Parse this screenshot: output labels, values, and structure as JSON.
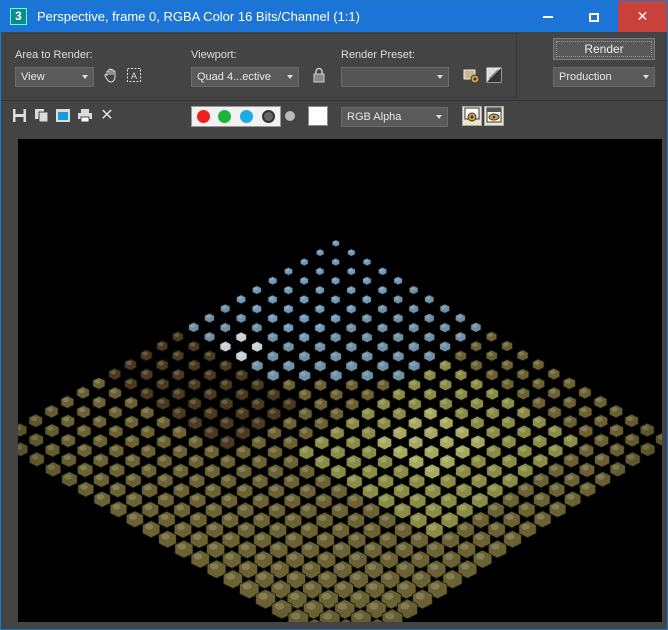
{
  "title": {
    "app_icon_text": "3",
    "text": "Perspective, frame 0, RGBA Color 16 Bits/Channel (1:1)",
    "minimize": "minimize",
    "maximize": "maximize",
    "close": "✕"
  },
  "settings": {
    "area_label": "Area to Render:",
    "area_value": "View",
    "viewport_label": "Viewport:",
    "viewport_value": "Quad 4...ective",
    "preset_label": "Render Preset:",
    "preset_value": "",
    "render_label": "Render",
    "production_value": "Production"
  },
  "toolbar": {
    "channel_value": "RGB Alpha",
    "clear_icon": "✕"
  },
  "colors": {
    "titlebar": "#1c75d6",
    "close_button": "#c8413a",
    "panel": "#444444",
    "render_background": "#000000"
  }
}
